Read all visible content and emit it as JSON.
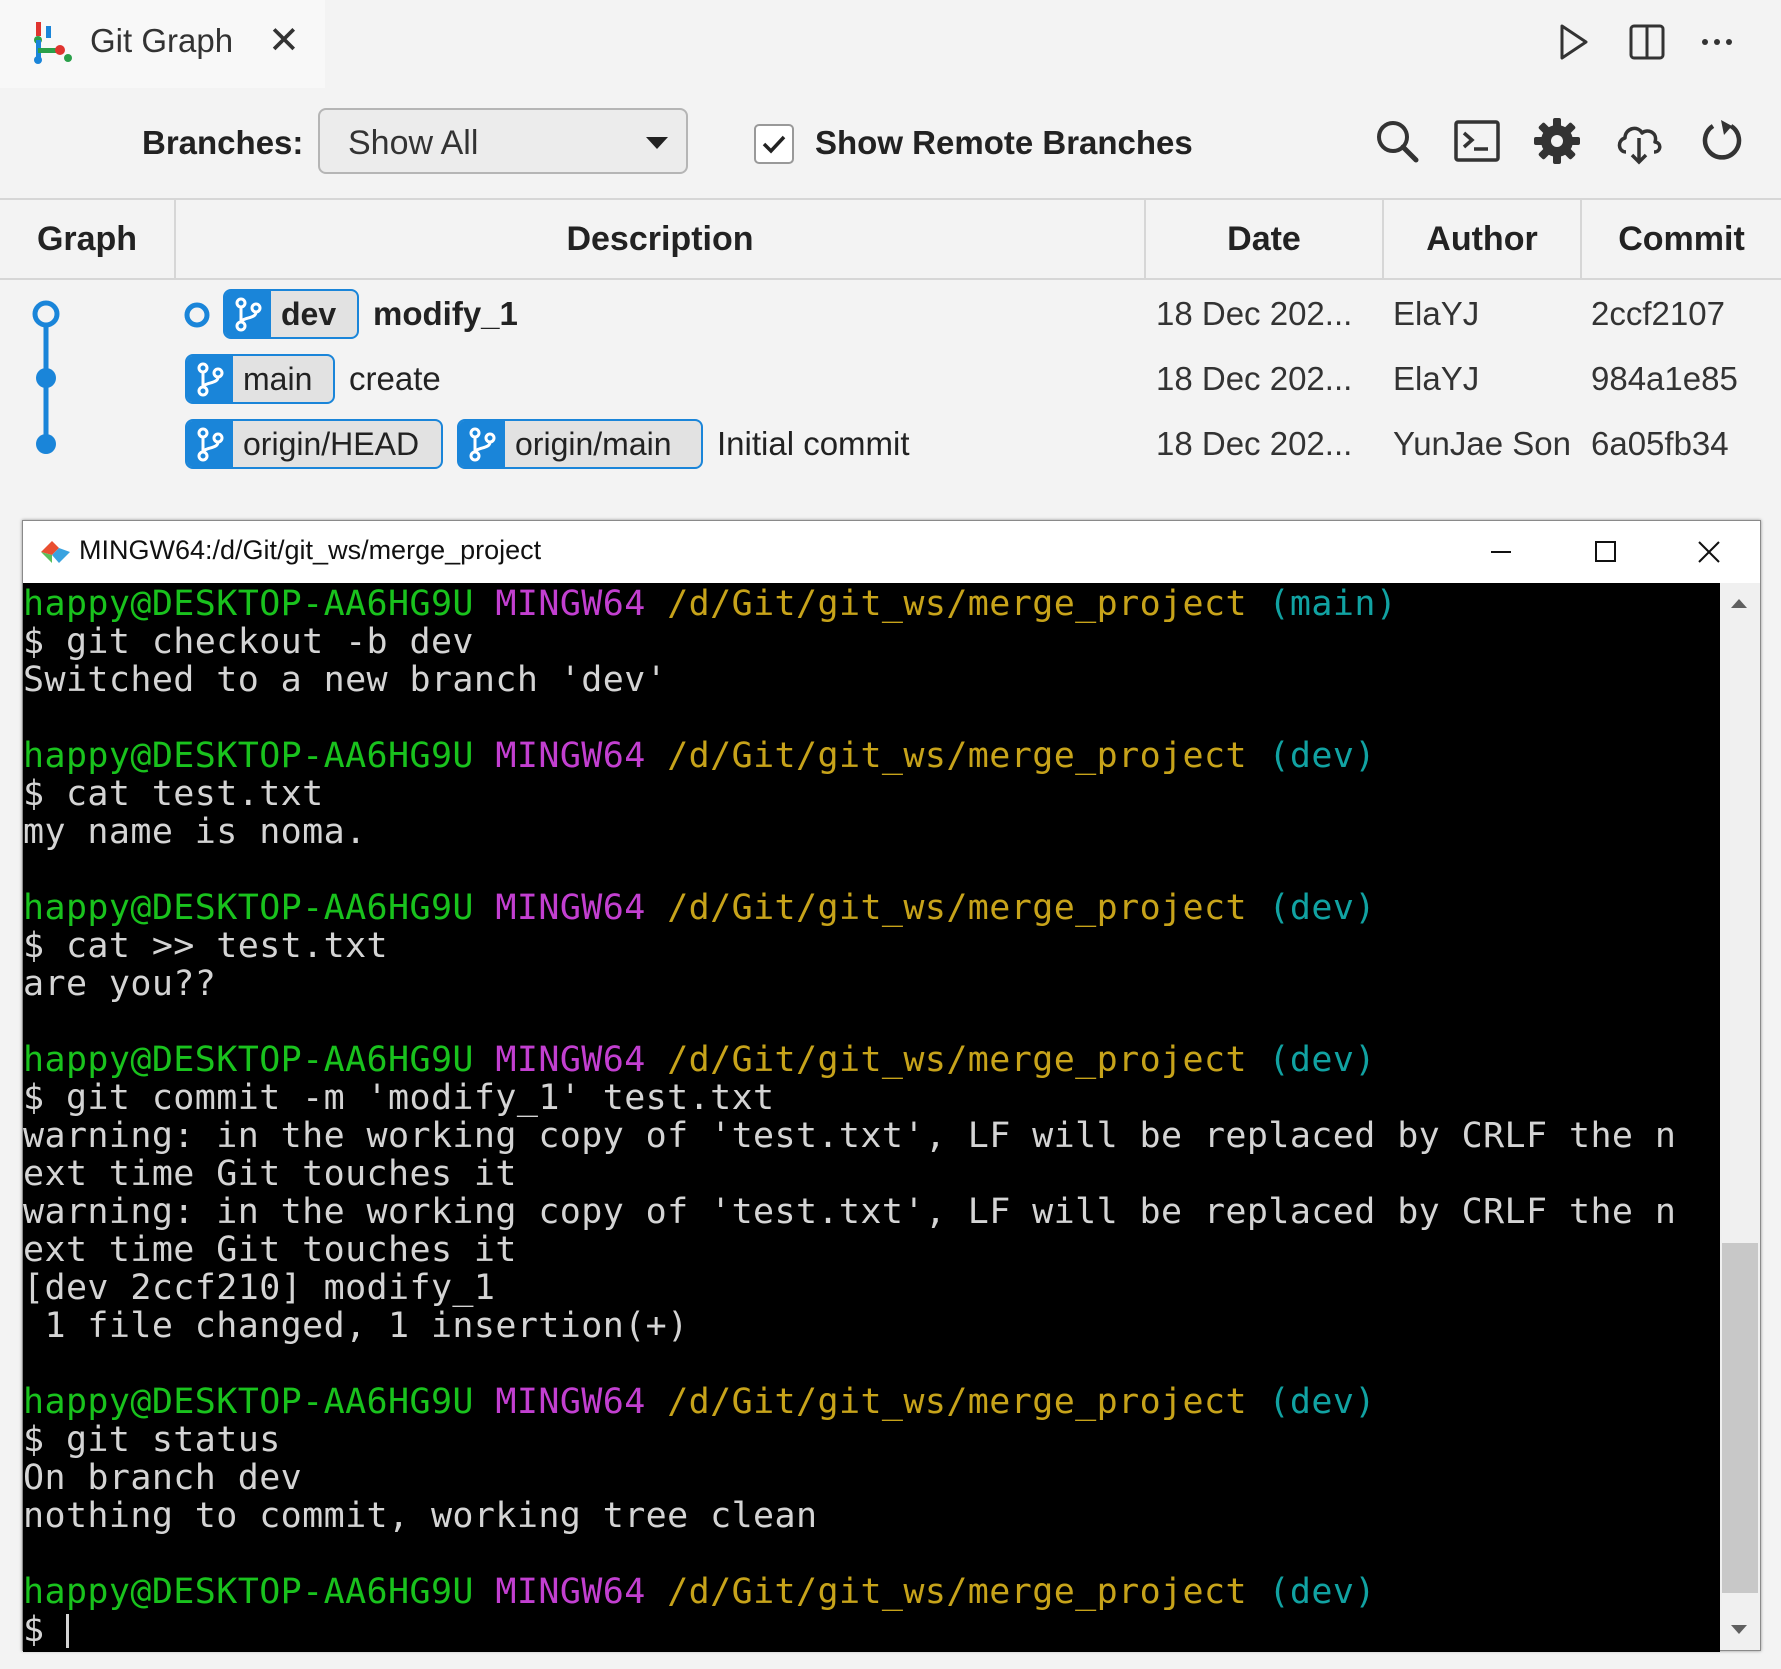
{
  "tab": {
    "title": "Git Graph",
    "close": "✕"
  },
  "toolbar": {
    "branches_label": "Branches:",
    "branches_value": "Show All",
    "show_remote_label": "Show Remote Branches",
    "show_remote_checked": true
  },
  "columns": [
    "Graph",
    "Description",
    "Date",
    "Author",
    "Commit"
  ],
  "commits": [
    {
      "refs": [
        "dev"
      ],
      "message": "modify_1",
      "date": "18 Dec 202...",
      "author": "ElaYJ",
      "hash": "2ccf2107"
    },
    {
      "refs": [
        "main"
      ],
      "message": "create",
      "date": "18 Dec 202...",
      "author": "ElaYJ",
      "hash": "984a1e85"
    },
    {
      "refs": [
        "origin/HEAD",
        "origin/main"
      ],
      "message": "Initial commit",
      "date": "18 Dec 202...",
      "author": "YunJae Son",
      "hash": "6a05fb34"
    }
  ],
  "colors": {
    "graph_blue": "#1a85d9",
    "term_green": "#19c21d",
    "term_magenta": "#c23fd0",
    "term_yellow": "#c7a31a",
    "term_cyan": "#11a2a2"
  },
  "terminal": {
    "title": "MINGW64:/d/Git/git_ws/merge_project",
    "prompt_user": "happy@DESKTOP-AA6HG9U",
    "prompt_sys": "MINGW64",
    "prompt_path": "/d/Git/git_ws/merge_project",
    "branch_main": "(main)",
    "branch_dev": "(dev)",
    "lines": {
      "cmd1": "$ git checkout -b dev",
      "out1": "Switched to a new branch 'dev'",
      "cmd2": "$ cat test.txt",
      "out2": "my name is noma.",
      "cmd3": "$ cat >> test.txt",
      "out3": "are you??",
      "cmd4": "$ git commit -m 'modify_1' test.txt",
      "out4a": "warning: in the working copy of 'test.txt', LF will be replaced by CRLF the n",
      "out4b": "ext time Git touches it",
      "out4c": "warning: in the working copy of 'test.txt', LF will be replaced by CRLF the n",
      "out4d": "ext time Git touches it",
      "out4e": "[dev 2ccf210] modify_1",
      "out4f": " 1 file changed, 1 insertion(+)",
      "cmd5": "$ git status",
      "out5a": "On branch dev",
      "out5b": "nothing to commit, working tree clean",
      "cmd6": "$ "
    }
  }
}
